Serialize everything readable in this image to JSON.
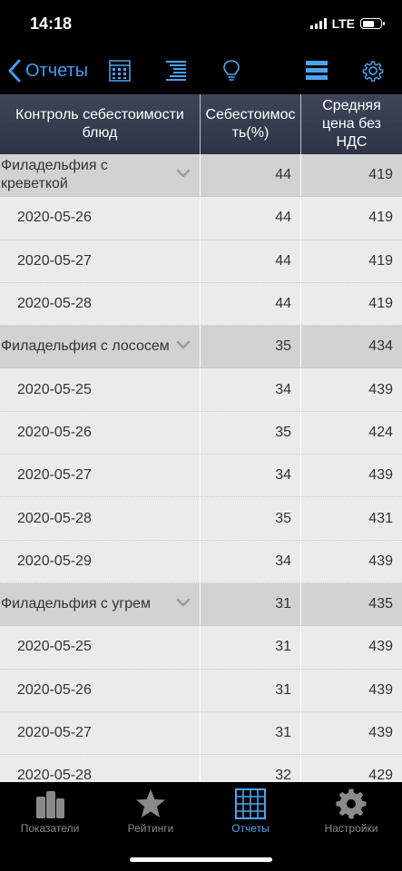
{
  "status": {
    "time": "14:18",
    "network": "LTE"
  },
  "nav": {
    "back_label": "Отчеты"
  },
  "table": {
    "headers": [
      "Контроль себестоимости блюд",
      "Себестоимос ть(%)",
      "Средняя цена без НДС"
    ],
    "rows": [
      {
        "type": "group",
        "name": "Филадельфия с креветкой",
        "cost": "44",
        "price": "419"
      },
      {
        "type": "item",
        "name": "2020-05-26",
        "cost": "44",
        "price": "419"
      },
      {
        "type": "item",
        "name": "2020-05-27",
        "cost": "44",
        "price": "419"
      },
      {
        "type": "item",
        "name": "2020-05-28",
        "cost": "44",
        "price": "419"
      },
      {
        "type": "group",
        "name": "Филадельфия с лососем",
        "cost": "35",
        "price": "434"
      },
      {
        "type": "item",
        "name": "2020-05-25",
        "cost": "34",
        "price": "439"
      },
      {
        "type": "item",
        "name": "2020-05-26",
        "cost": "35",
        "price": "424"
      },
      {
        "type": "item",
        "name": "2020-05-27",
        "cost": "34",
        "price": "439"
      },
      {
        "type": "item",
        "name": "2020-05-28",
        "cost": "35",
        "price": "431"
      },
      {
        "type": "item",
        "name": "2020-05-29",
        "cost": "34",
        "price": "439"
      },
      {
        "type": "group",
        "name": "Филадельфия с угрем",
        "cost": "31",
        "price": "435"
      },
      {
        "type": "item",
        "name": "2020-05-25",
        "cost": "31",
        "price": "439"
      },
      {
        "type": "item",
        "name": "2020-05-26",
        "cost": "31",
        "price": "439"
      },
      {
        "type": "item",
        "name": "2020-05-27",
        "cost": "31",
        "price": "439"
      },
      {
        "type": "item",
        "name": "2020-05-28",
        "cost": "32",
        "price": "429"
      }
    ]
  },
  "tabs": [
    {
      "label": "Показатели",
      "icon": "dashboard-icon",
      "active": false
    },
    {
      "label": "Рейтинги",
      "icon": "star-icon",
      "active": false
    },
    {
      "label": "Отчеты",
      "icon": "grid-icon",
      "active": true
    },
    {
      "label": "Настройки",
      "icon": "gear-icon",
      "active": false
    }
  ],
  "colors": {
    "accent": "#4aa4f4",
    "header_bg": "#3d4557",
    "group_row": "#d2d2d2",
    "item_row": "#ebebeb"
  }
}
